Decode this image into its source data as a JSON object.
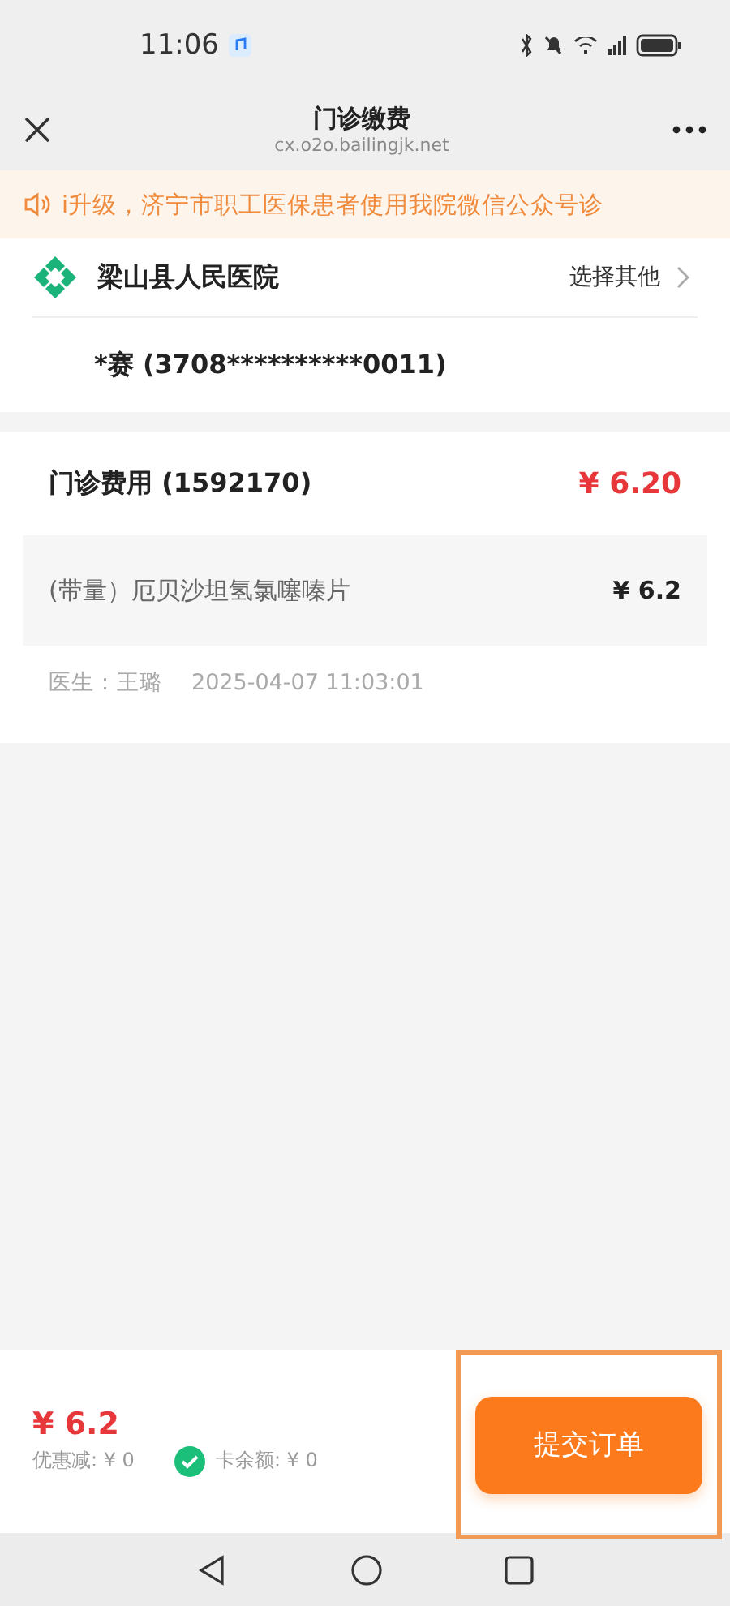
{
  "status_bar": {
    "time": "11:06"
  },
  "nav": {
    "title": "门诊缴费",
    "url": "cx.o2o.bailingjk.net"
  },
  "notice": {
    "text": "i升级，济宁市职工医保患者使用我院微信公众号诊"
  },
  "hospital": {
    "name": "梁山县人民医院",
    "action": "选择其他",
    "patient": "*赛 (3708**********0011)"
  },
  "fee": {
    "title": "门诊费用 (1592170)",
    "total": "¥ 6.20",
    "items": [
      {
        "name": "(带量）厄贝沙坦氢氯噻嗪片",
        "price": "¥ 6.2"
      }
    ],
    "doctor": "医生：王璐",
    "time": "2025-04-07 11:03:01"
  },
  "footer": {
    "amount": "¥ 6.2",
    "discount": "优惠减: ¥ 0",
    "card_checked": true,
    "card_balance": "卡余额: ¥ 0",
    "submit": "提交订单"
  }
}
